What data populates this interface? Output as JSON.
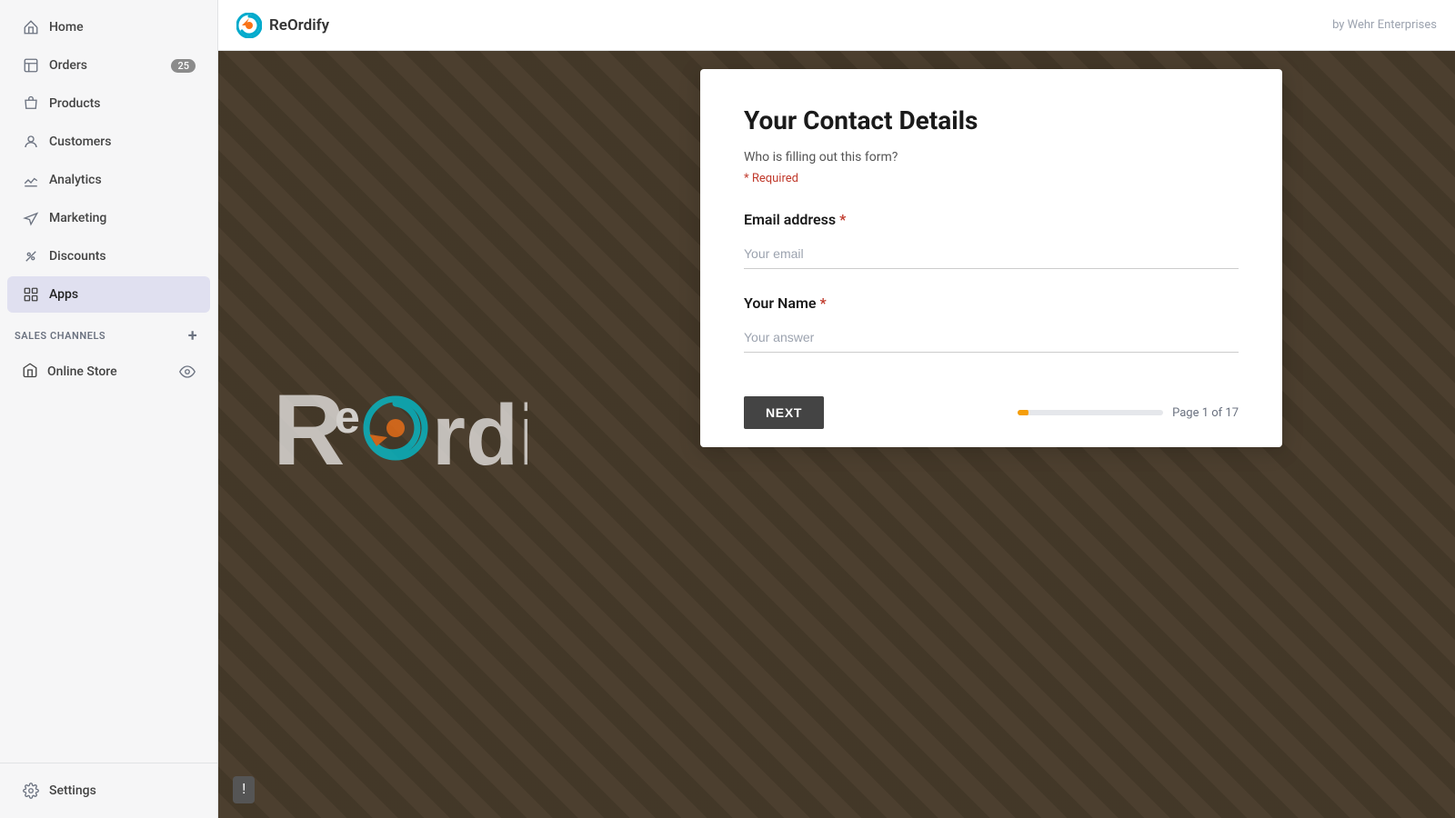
{
  "topbar": {
    "logo_text": "ReOrdify",
    "brand_text": "by Wehr Enterprises"
  },
  "sidebar": {
    "nav_items": [
      {
        "id": "home",
        "label": "Home",
        "icon": "home-icon",
        "badge": null,
        "active": false
      },
      {
        "id": "orders",
        "label": "Orders",
        "icon": "orders-icon",
        "badge": "25",
        "active": false
      },
      {
        "id": "products",
        "label": "Products",
        "icon": "products-icon",
        "badge": null,
        "active": false
      },
      {
        "id": "customers",
        "label": "Customers",
        "icon": "customers-icon",
        "badge": null,
        "active": false
      },
      {
        "id": "analytics",
        "label": "Analytics",
        "icon": "analytics-icon",
        "badge": null,
        "active": false
      },
      {
        "id": "marketing",
        "label": "Marketing",
        "icon": "marketing-icon",
        "badge": null,
        "active": false
      },
      {
        "id": "discounts",
        "label": "Discounts",
        "icon": "discounts-icon",
        "badge": null,
        "active": false
      },
      {
        "id": "apps",
        "label": "Apps",
        "icon": "apps-icon",
        "badge": null,
        "active": true
      }
    ],
    "sales_channels_label": "SALES CHANNELS",
    "online_store_label": "Online Store",
    "settings_label": "Settings"
  },
  "form": {
    "title": "Your Contact Details",
    "subtitle": "Who is filling out this form?",
    "required_label": "* Required",
    "email_label": "Email address",
    "email_placeholder": "Your email",
    "name_label": "Your Name",
    "name_placeholder": "Your answer",
    "next_button": "NEXT",
    "page_info": "Page 1 of 17"
  },
  "feedback": {
    "icon": "!"
  }
}
